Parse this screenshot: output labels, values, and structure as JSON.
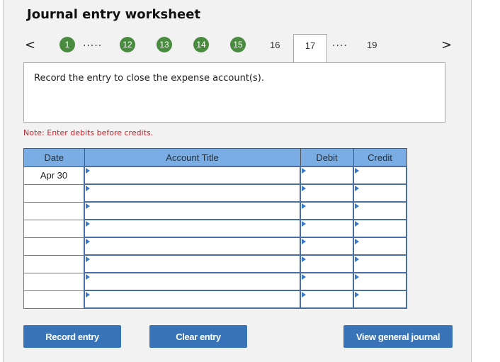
{
  "header": {
    "title": "Journal entry worksheet"
  },
  "nav": {
    "prev_icon": "chevron-left-icon",
    "next_icon": "chevron-right-icon",
    "prev_glyph": "<",
    "next_glyph": ">",
    "completed_steps": [
      "1",
      "12",
      "13",
      "14",
      "15"
    ],
    "ellipsis_1": ".....",
    "steps_plain": [
      "16",
      "19"
    ],
    "active_step": "17",
    "ellipsis_2": "....",
    "completed_color": "#4a8c3f"
  },
  "prompt": {
    "text": "Record the entry to close the expense account(s)."
  },
  "note": {
    "text": "Note: Enter debits before credits.",
    "color": "#c0272d"
  },
  "table": {
    "headers": {
      "date": "Date",
      "account": "Account Title",
      "debit": "Debit",
      "credit": "Credit"
    },
    "header_color": "#7aade3",
    "rows": [
      {
        "date": "Apr 30",
        "account": "",
        "debit": "",
        "credit": ""
      },
      {
        "date": "",
        "account": "",
        "debit": "",
        "credit": ""
      },
      {
        "date": "",
        "account": "",
        "debit": "",
        "credit": ""
      },
      {
        "date": "",
        "account": "",
        "debit": "",
        "credit": ""
      },
      {
        "date": "",
        "account": "",
        "debit": "",
        "credit": ""
      },
      {
        "date": "",
        "account": "",
        "debit": "",
        "credit": ""
      },
      {
        "date": "",
        "account": "",
        "debit": "",
        "credit": ""
      },
      {
        "date": "",
        "account": "",
        "debit": "",
        "credit": ""
      }
    ]
  },
  "buttons": {
    "record": "Record entry",
    "clear": "Clear entry",
    "view_journal": "View general journal",
    "color": "#3a74b8"
  }
}
